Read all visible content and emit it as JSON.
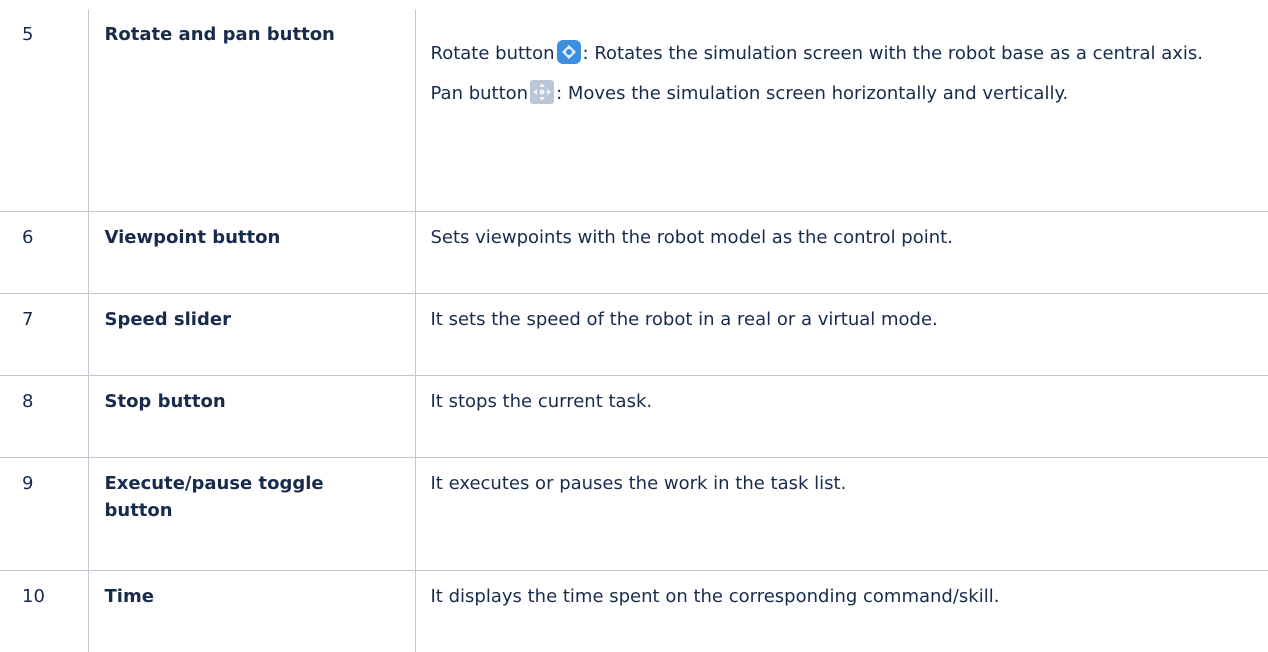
{
  "rows": [
    {
      "number": "5",
      "name": "Rotate and pan button",
      "rotate_label": "Rotate button",
      "rotate_text": ": Rotates the simulation screen with the robot base as a central axis.",
      "pan_label": "Pan button",
      "pan_text": ": Moves the simulation screen horizontally and vertically.",
      "rotate_icon": "rotate-icon",
      "pan_icon": "pan-icon"
    },
    {
      "number": "6",
      "name": "Viewpoint button",
      "description": "Sets viewpoints with the robot model as the control point."
    },
    {
      "number": "7",
      "name": "Speed slider",
      "description": "It sets the speed of the robot in a real or a virtual mode."
    },
    {
      "number": "8",
      "name": "Stop button",
      "description": "It stops the current task."
    },
    {
      "number": "9",
      "name": "Execute/pause toggle button",
      "description": "It executes or pauses the work in the task list."
    },
    {
      "number": "10",
      "name": "Time",
      "description": "It displays the time spent on the corresponding command/skill."
    }
  ],
  "colors": {
    "text": "#172b4d",
    "border": "#c1c7d0",
    "rotate_icon": "#3b8fe0",
    "pan_icon": "#b9c6d8"
  }
}
